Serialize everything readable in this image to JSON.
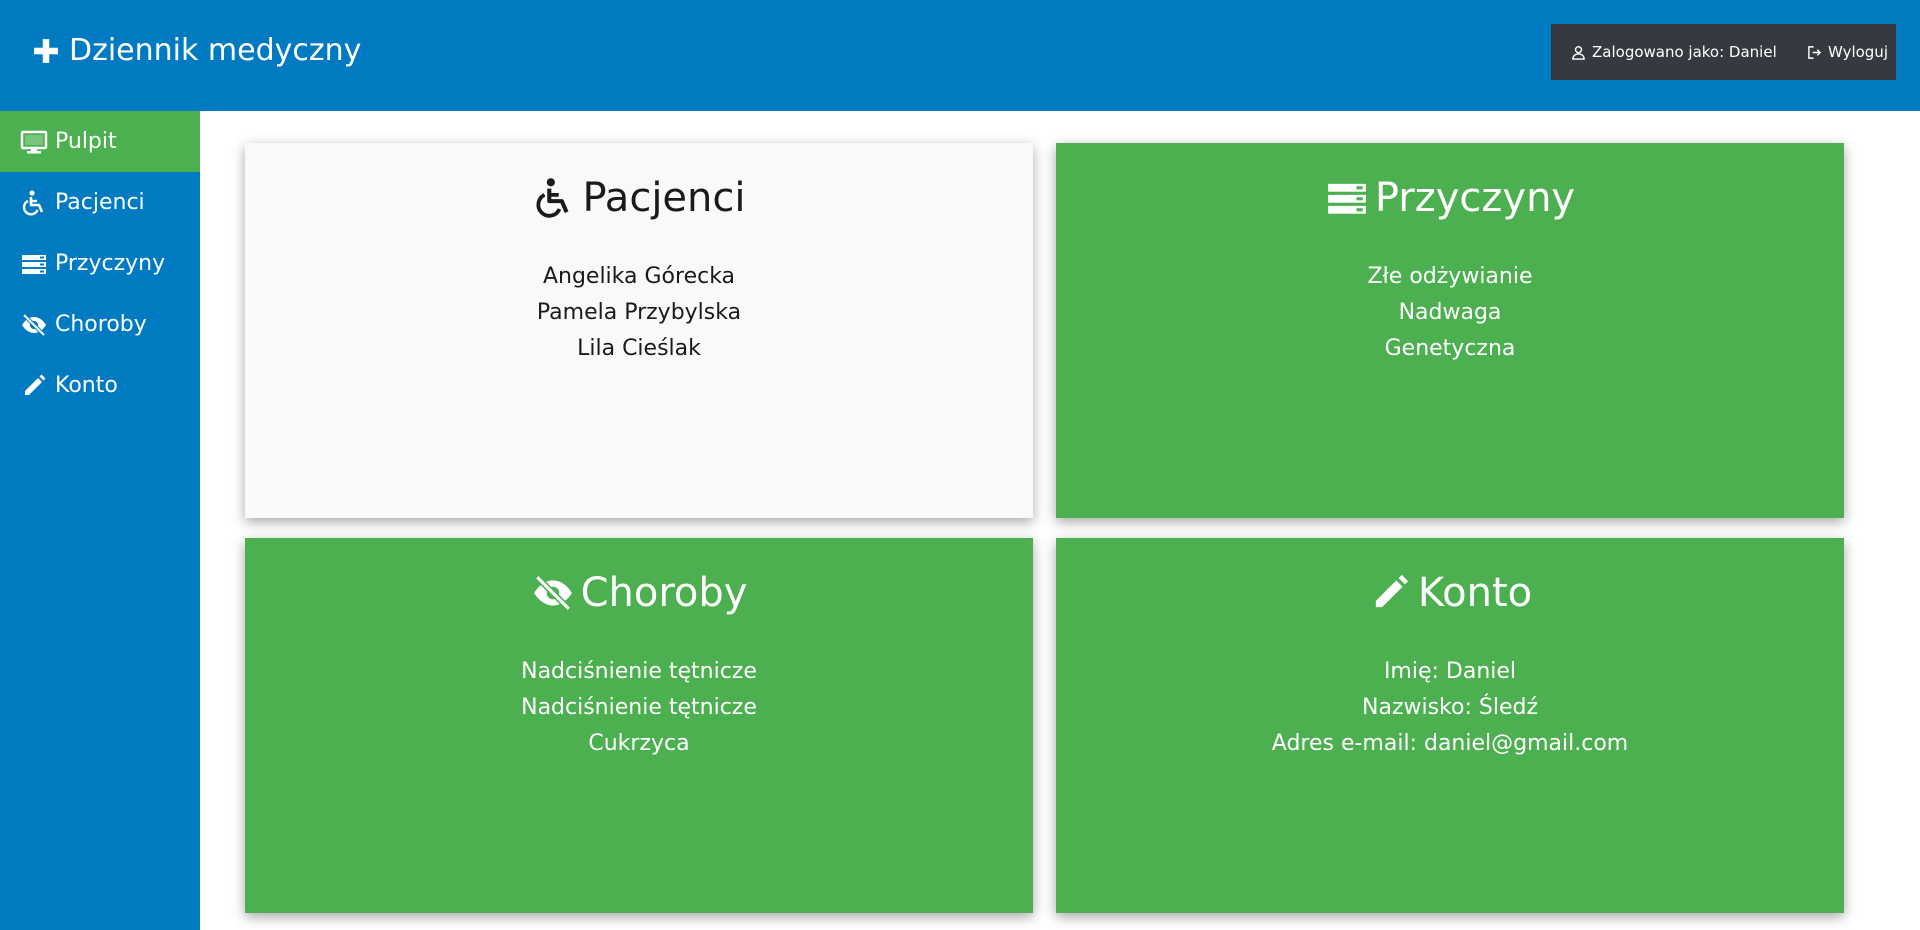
{
  "app": {
    "title": "Dziennik medyczny"
  },
  "header": {
    "logged_in_label": "Zalogowano jako: Daniel",
    "logout_label": "Wyloguj"
  },
  "sidebar": {
    "items": [
      {
        "label": "Pulpit",
        "icon": "monitor-icon",
        "active": true
      },
      {
        "label": "Pacjenci",
        "icon": "wheelchair-icon",
        "active": false
      },
      {
        "label": "Przyczyny",
        "icon": "server-icon",
        "active": false
      },
      {
        "label": "Choroby",
        "icon": "eye-slash-icon",
        "active": false
      },
      {
        "label": "Konto",
        "icon": "pencil-icon",
        "active": false
      }
    ]
  },
  "cards": {
    "patients": {
      "title": "Pacjenci",
      "icon": "wheelchair-icon",
      "items": [
        "Angelika Górecka",
        "Pamela Przybylska",
        "Lila Cieślak"
      ]
    },
    "causes": {
      "title": "Przyczyny",
      "icon": "server-icon",
      "items": [
        "Złe odżywianie",
        "Nadwaga",
        "Genetyczna"
      ]
    },
    "diseases": {
      "title": "Choroby",
      "icon": "eye-slash-icon",
      "items": [
        "Nadciśnienie tętnicze",
        "Nadciśnienie tętnicze",
        "Cukrzyca"
      ]
    },
    "account": {
      "title": "Konto",
      "icon": "pencil-icon",
      "items": [
        "Imię: Daniel",
        "Nazwisko: Śledź",
        "Adres e-mail: daniel@gmail.com"
      ]
    }
  },
  "colors": {
    "primary_blue": "#007bc2",
    "accent_green": "#4cb050",
    "dark_box": "#343a40",
    "card_white": "#f8f9f8"
  }
}
